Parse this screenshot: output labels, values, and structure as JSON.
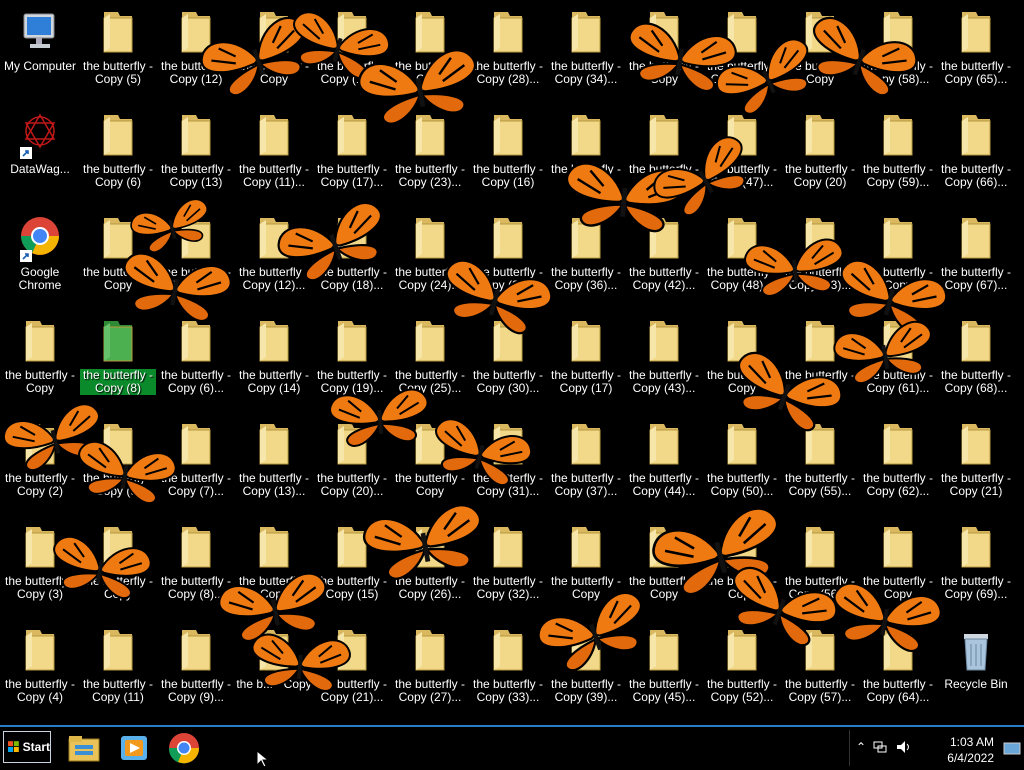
{
  "desktop_icons": [
    {
      "name": "my-computer-icon",
      "type": "computer",
      "label": "My Computer",
      "col": 0,
      "row": 0
    },
    {
      "name": "datawag-icon",
      "type": "datawag",
      "label": "DataWag...",
      "col": 0,
      "row": 1
    },
    {
      "name": "google-chrome-icon",
      "type": "chrome",
      "label": "Google Chrome",
      "col": 0,
      "row": 2
    },
    {
      "name": "folder-icon",
      "type": "folder",
      "label": "the butterfly - Copy",
      "col": 0,
      "row": 3
    },
    {
      "name": "folder-icon",
      "type": "folder",
      "label": "the butterfly - Copy (2)",
      "col": 0,
      "row": 4
    },
    {
      "name": "folder-icon",
      "type": "folder",
      "label": "the butterfly - Copy (3)",
      "col": 0,
      "row": 5
    },
    {
      "name": "folder-icon",
      "type": "folder",
      "label": "the butterfly - Copy (4)",
      "col": 0,
      "row": 6
    },
    {
      "name": "folder-icon",
      "type": "folder",
      "label": "the butterfly - Copy (5)",
      "col": 1,
      "row": 0
    },
    {
      "name": "folder-icon",
      "type": "folder",
      "label": "the butterfly - Copy (6)",
      "col": 1,
      "row": 1
    },
    {
      "name": "folder-icon",
      "type": "folder",
      "label": "the butterfly - Copy",
      "col": 1,
      "row": 2
    },
    {
      "name": "folder-icon",
      "type": "folder-green",
      "label": "the butterfly - Copy (8)",
      "col": 1,
      "row": 3,
      "selected": true
    },
    {
      "name": "folder-icon",
      "type": "folder",
      "label": "the butterfly - Copy (9)",
      "col": 1,
      "row": 4
    },
    {
      "name": "folder-icon",
      "type": "folder",
      "label": "the butterfly - Copy",
      "col": 1,
      "row": 5
    },
    {
      "name": "folder-icon",
      "type": "folder",
      "label": "the butterfly - Copy (11)",
      "col": 1,
      "row": 6
    },
    {
      "name": "folder-icon",
      "type": "folder",
      "label": "the butterfly - Copy (12)",
      "col": 2,
      "row": 0
    },
    {
      "name": "folder-icon",
      "type": "folder",
      "label": "the butterfly - Copy (13)",
      "col": 2,
      "row": 1
    },
    {
      "name": "folder-icon",
      "type": "folder",
      "label": "the butterfly - Copy (5)...",
      "col": 2,
      "row": 2
    },
    {
      "name": "folder-icon",
      "type": "folder",
      "label": "the butterfly - Copy (6)...",
      "col": 2,
      "row": 3
    },
    {
      "name": "folder-icon",
      "type": "folder",
      "label": "the butterfly - Copy (7)...",
      "col": 2,
      "row": 4
    },
    {
      "name": "folder-icon",
      "type": "folder",
      "label": "the butterfly - Copy (8)...",
      "col": 2,
      "row": 5
    },
    {
      "name": "folder-icon",
      "type": "folder",
      "label": "the butterfly - Copy (9)...",
      "col": 2,
      "row": 6
    },
    {
      "name": "folder-icon",
      "type": "folder",
      "label": "the butterfly - Copy",
      "col": 3,
      "row": 0
    },
    {
      "name": "folder-icon",
      "type": "folder",
      "label": "the butterfly - Copy (11)...",
      "col": 3,
      "row": 1
    },
    {
      "name": "folder-icon",
      "type": "folder",
      "label": "the butterfly - Copy (12)...",
      "col": 3,
      "row": 2
    },
    {
      "name": "folder-icon",
      "type": "folder",
      "label": "the butterfly - Copy (14)",
      "col": 3,
      "row": 3
    },
    {
      "name": "folder-icon",
      "type": "folder",
      "label": "the butterfly - Copy (13)...",
      "col": 3,
      "row": 4
    },
    {
      "name": "folder-icon",
      "type": "folder",
      "label": "the butterfly - Copy",
      "col": 3,
      "row": 5
    },
    {
      "name": "folder-icon",
      "type": "folder",
      "label": "the b... - Copy",
      "col": 3,
      "row": 6
    },
    {
      "name": "folder-icon",
      "type": "folder",
      "label": "the butterfly - Copy (16)...",
      "col": 4,
      "row": 0
    },
    {
      "name": "folder-icon",
      "type": "folder",
      "label": "the butterfly - Copy (17)...",
      "col": 4,
      "row": 1
    },
    {
      "name": "folder-icon",
      "type": "folder",
      "label": "the butterfly - Copy (18)...",
      "col": 4,
      "row": 2
    },
    {
      "name": "folder-icon",
      "type": "folder",
      "label": "the butterfly - Copy (19)...",
      "col": 4,
      "row": 3
    },
    {
      "name": "folder-icon",
      "type": "folder",
      "label": "the butterfly - Copy (20)...",
      "col": 4,
      "row": 4
    },
    {
      "name": "folder-icon",
      "type": "folder",
      "label": "the butterfly - Copy (15)",
      "col": 4,
      "row": 5
    },
    {
      "name": "folder-icon",
      "type": "folder",
      "label": "the butterfly - Copy (21)...",
      "col": 4,
      "row": 6
    },
    {
      "name": "folder-icon",
      "type": "folder",
      "label": "the butterfly - Copy",
      "col": 5,
      "row": 0
    },
    {
      "name": "folder-icon",
      "type": "folder",
      "label": "the butterfly - Copy (23)...",
      "col": 5,
      "row": 1
    },
    {
      "name": "folder-icon",
      "type": "folder",
      "label": "the butterfly - Copy (24)...",
      "col": 5,
      "row": 2
    },
    {
      "name": "folder-icon",
      "type": "folder",
      "label": "the butterfly - Copy (25)...",
      "col": 5,
      "row": 3
    },
    {
      "name": "folder-icon",
      "type": "folder",
      "label": "the butterfly - Copy",
      "col": 5,
      "row": 4
    },
    {
      "name": "folder-icon",
      "type": "folder",
      "label": "the butterfly - Copy (26)...",
      "col": 5,
      "row": 5
    },
    {
      "name": "folder-icon",
      "type": "folder",
      "label": "the butterfly - Copy (27)...",
      "col": 5,
      "row": 6
    },
    {
      "name": "folder-icon",
      "type": "folder",
      "label": "the butterfly - Copy (28)...",
      "col": 6,
      "row": 0
    },
    {
      "name": "folder-icon",
      "type": "folder",
      "label": "the butterfly - Copy (16)",
      "col": 6,
      "row": 1
    },
    {
      "name": "folder-icon",
      "type": "folder",
      "label": "the butterfly - Copy (29)...",
      "col": 6,
      "row": 2
    },
    {
      "name": "folder-icon",
      "type": "folder",
      "label": "the butterfly - Copy (30)...",
      "col": 6,
      "row": 3
    },
    {
      "name": "folder-icon",
      "type": "folder",
      "label": "the butterfly - Copy (31)...",
      "col": 6,
      "row": 4
    },
    {
      "name": "folder-icon",
      "type": "folder",
      "label": "the butterfly - Copy (32)...",
      "col": 6,
      "row": 5
    },
    {
      "name": "folder-icon",
      "type": "folder",
      "label": "the butterfly - Copy (33)...",
      "col": 6,
      "row": 6
    },
    {
      "name": "folder-icon",
      "type": "folder",
      "label": "the butterfly - Copy (34)...",
      "col": 7,
      "row": 0
    },
    {
      "name": "folder-icon",
      "type": "folder",
      "label": "the butterfly - Copy",
      "col": 7,
      "row": 1
    },
    {
      "name": "folder-icon",
      "type": "folder",
      "label": "the butterfly - Copy (36)...",
      "col": 7,
      "row": 2
    },
    {
      "name": "folder-icon",
      "type": "folder",
      "label": "the butterfly - Copy (17)",
      "col": 7,
      "row": 3
    },
    {
      "name": "folder-icon",
      "type": "folder",
      "label": "the butterfly - Copy (37)...",
      "col": 7,
      "row": 4
    },
    {
      "name": "folder-icon",
      "type": "folder",
      "label": "the butterfly - Copy",
      "col": 7,
      "row": 5
    },
    {
      "name": "folder-icon",
      "type": "folder",
      "label": "the butterfly - Copy (39)...",
      "col": 7,
      "row": 6
    },
    {
      "name": "folder-icon",
      "type": "folder",
      "label": "the butterfly - Copy",
      "col": 8,
      "row": 0
    },
    {
      "name": "folder-icon",
      "type": "folder",
      "label": "the butterfly - Copy",
      "col": 8,
      "row": 1
    },
    {
      "name": "folder-icon",
      "type": "folder",
      "label": "the butterfly - Copy (42)...",
      "col": 8,
      "row": 2
    },
    {
      "name": "folder-icon",
      "type": "folder",
      "label": "the butterfly - Copy (43)...",
      "col": 8,
      "row": 3
    },
    {
      "name": "folder-icon",
      "type": "folder",
      "label": "the butterfly - Copy (44)...",
      "col": 8,
      "row": 4
    },
    {
      "name": "folder-icon",
      "type": "folder",
      "label": "the butterfly - Copy",
      "col": 8,
      "row": 5
    },
    {
      "name": "folder-icon",
      "type": "folder",
      "label": "the butterfly - Copy (45)...",
      "col": 8,
      "row": 6
    },
    {
      "name": "folder-icon",
      "type": "folder",
      "label": "the butterfly - Copy (46)...",
      "col": 9,
      "row": 0
    },
    {
      "name": "folder-icon",
      "type": "folder",
      "label": "the butterfly - Copy (47)...",
      "col": 9,
      "row": 1
    },
    {
      "name": "folder-icon",
      "type": "folder",
      "label": "the butterfly - Copy (48)...",
      "col": 9,
      "row": 2
    },
    {
      "name": "folder-icon",
      "type": "folder",
      "label": "the butterfly - Copy",
      "col": 9,
      "row": 3
    },
    {
      "name": "folder-icon",
      "type": "folder",
      "label": "the butterfly - Copy (50)...",
      "col": 9,
      "row": 4
    },
    {
      "name": "folder-icon",
      "type": "folder",
      "label": "the butterfly - Copy",
      "col": 9,
      "row": 5
    },
    {
      "name": "folder-icon",
      "type": "folder",
      "label": "the butterfly - Copy (52)...",
      "col": 9,
      "row": 6
    },
    {
      "name": "folder-icon",
      "type": "folder",
      "label": "the butterfly - Copy",
      "col": 10,
      "row": 0
    },
    {
      "name": "folder-icon",
      "type": "folder",
      "label": "the butterfly - Copy (20)",
      "col": 10,
      "row": 1
    },
    {
      "name": "folder-icon",
      "type": "folder",
      "label": "the butterfly - Copy (53)...",
      "col": 10,
      "row": 2
    },
    {
      "name": "folder-icon",
      "type": "folder",
      "label": "the butterfly - Copy",
      "col": 10,
      "row": 3
    },
    {
      "name": "folder-icon",
      "type": "folder",
      "label": "the butterfly - Copy (55)...",
      "col": 10,
      "row": 4
    },
    {
      "name": "folder-icon",
      "type": "folder",
      "label": "the butterfly - Copy (56)...",
      "col": 10,
      "row": 5
    },
    {
      "name": "folder-icon",
      "type": "folder",
      "label": "the butterfly - Copy (57)...",
      "col": 10,
      "row": 6
    },
    {
      "name": "folder-icon",
      "type": "folder",
      "label": "the butterfly - Copy (58)...",
      "col": 11,
      "row": 0
    },
    {
      "name": "folder-icon",
      "type": "folder",
      "label": "the butterfly - Copy (59)...",
      "col": 11,
      "row": 1
    },
    {
      "name": "folder-icon",
      "type": "folder",
      "label": "the butterfly - Copy",
      "col": 11,
      "row": 2
    },
    {
      "name": "folder-icon",
      "type": "folder",
      "label": "the butterfly - Copy (61)...",
      "col": 11,
      "row": 3
    },
    {
      "name": "folder-icon",
      "type": "folder",
      "label": "the butterfly - Copy (62)...",
      "col": 11,
      "row": 4
    },
    {
      "name": "folder-icon",
      "type": "folder",
      "label": "the butterfly - Copy",
      "col": 11,
      "row": 5
    },
    {
      "name": "folder-icon",
      "type": "folder",
      "label": "the butterfly - Copy (64)...",
      "col": 11,
      "row": 6
    },
    {
      "name": "folder-icon",
      "type": "folder",
      "label": "the butterfly - Copy (65)...",
      "col": 12,
      "row": 0
    },
    {
      "name": "folder-icon",
      "type": "folder",
      "label": "the butterfly - Copy (66)...",
      "col": 12,
      "row": 1
    },
    {
      "name": "folder-icon",
      "type": "folder",
      "label": "the butterfly - Copy (67)...",
      "col": 12,
      "row": 2
    },
    {
      "name": "folder-icon",
      "type": "folder",
      "label": "the butterfly - Copy (68)...",
      "col": 12,
      "row": 3
    },
    {
      "name": "folder-icon",
      "type": "folder",
      "label": "the butterfly - Copy (21)",
      "col": 12,
      "row": 4
    },
    {
      "name": "folder-icon",
      "type": "folder",
      "label": "the butterfly - Copy (69)...",
      "col": 12,
      "row": 5
    },
    {
      "name": "recycle-bin-icon",
      "type": "recycle",
      "label": "Recycle Bin",
      "col": 12,
      "row": 6
    }
  ],
  "taskbar": {
    "start_label": "Start",
    "apps": [
      {
        "name": "file-explorer-icon"
      },
      {
        "name": "media-player-icon"
      },
      {
        "name": "chrome-taskbar-icon"
      }
    ]
  },
  "tray": {
    "time": "1:03 AM",
    "date": "6/4/2022",
    "icons": [
      "chevron-up-icon",
      "network-icon",
      "volume-icon"
    ]
  },
  "colors": {
    "background": "#000000",
    "selection": "#0a8a2a",
    "butterfly": "#f07a12",
    "taskbar_border": "#2a7dc9"
  }
}
